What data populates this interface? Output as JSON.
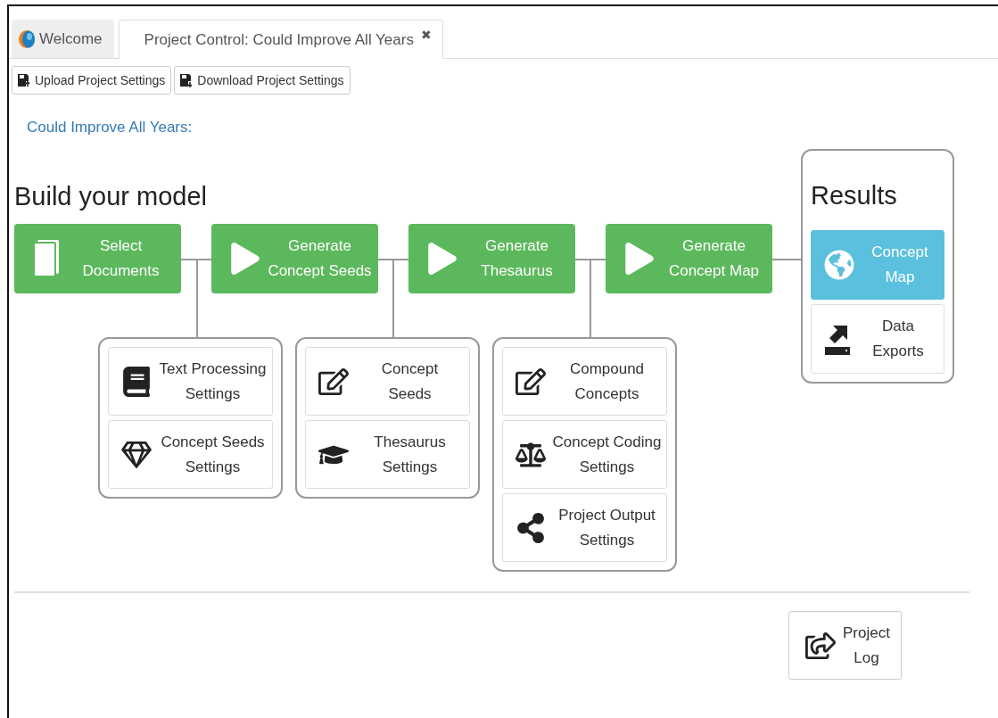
{
  "tabs": [
    {
      "label": "Welcome",
      "kind": "home",
      "selected": false
    },
    {
      "label": "Project Control: Could Improve All Years",
      "kind": "project",
      "close": "✖",
      "selected": true
    }
  ],
  "toolbar": [
    {
      "label": "Upload Project Settings",
      "kind": "upload"
    },
    {
      "label": "Download Project Settings",
      "kind": "download"
    }
  ],
  "project_link": "Could Improve All Years:",
  "build": {
    "heading": "Build your model",
    "steps": [
      {
        "label": "Select\nDocuments",
        "kind": "documents"
      },
      {
        "label": "Generate\nConcept Seeds",
        "kind": "play"
      },
      {
        "label": "Generate\nThesaurus",
        "kind": "play"
      },
      {
        "label": "Generate\nConcept Map",
        "kind": "play"
      }
    ],
    "groups": [
      [
        {
          "label": "Text Processing\nSettings",
          "kind": "book"
        },
        {
          "label": "Concept Seeds\nSettings",
          "kind": "gem"
        }
      ],
      [
        {
          "label": "Concept\nSeeds",
          "kind": "edit"
        },
        {
          "label": "Thesaurus\nSettings",
          "kind": "graduation"
        }
      ],
      [
        {
          "label": "Compound\nConcepts",
          "kind": "edit"
        },
        {
          "label": "Concept Coding\nSettings",
          "kind": "scale"
        },
        {
          "label": "Project Output\nSettings",
          "kind": "share"
        }
      ]
    ]
  },
  "results": {
    "heading": "Results",
    "items": [
      {
        "label": "Concept\nMap",
        "kind": "globe",
        "selected": true
      },
      {
        "label": "Data\nExports",
        "kind": "export",
        "selected": false
      }
    ]
  },
  "project_log": {
    "label": "Project\nLog"
  }
}
